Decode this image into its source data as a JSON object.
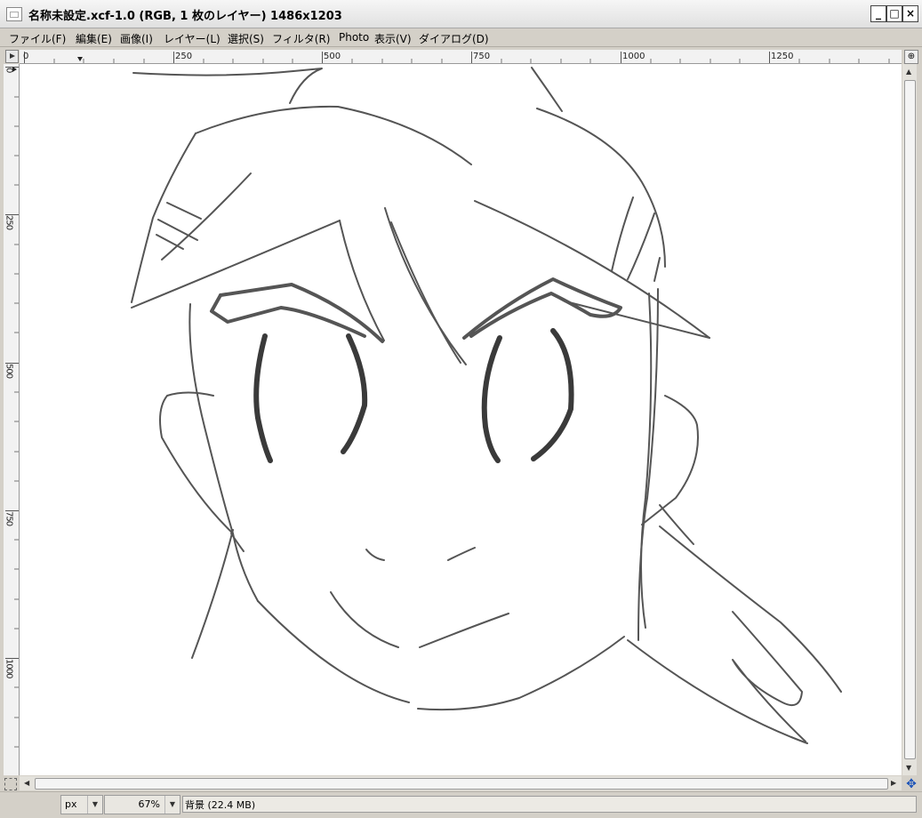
{
  "window": {
    "title": "名称未設定.xcf-1.0 (RGB, 1 枚のレイヤー) 1486x1203",
    "minimize_glyph": "_",
    "maximize_glyph": "□",
    "close_glyph": "×"
  },
  "menu": {
    "items": [
      {
        "label": "ファイル(F)"
      },
      {
        "label": "編集(E)"
      },
      {
        "label": "画像(I)"
      },
      {
        "label": "レイヤー(L)"
      },
      {
        "label": "選択(S)"
      },
      {
        "label": "フィルタ(R)"
      },
      {
        "label": "Photo"
      },
      {
        "label": "表示(V)"
      },
      {
        "label": "ダイアログ(D)"
      }
    ]
  },
  "rulers": {
    "horizontal_labels": [
      "0",
      "250",
      "500",
      "750",
      "1000",
      "1250"
    ],
    "vertical_labels": [
      "0",
      "250",
      "500",
      "750",
      "1000"
    ]
  },
  "status": {
    "unit": "px",
    "zoom": "67%",
    "message": "背景 (22.4 MB)"
  },
  "icons": {
    "corner": "quick-mask-menu-icon",
    "zoom": "zoom-image-icon",
    "navigate": "navigate-icon"
  }
}
